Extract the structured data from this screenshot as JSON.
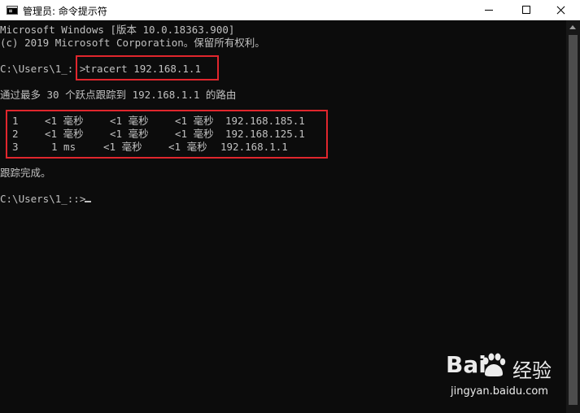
{
  "window": {
    "title": "管理员: 命令提示符",
    "icon": "cmd-icon"
  },
  "console": {
    "lines": [
      "Microsoft Windows [版本 10.0.18363.900]",
      "(c) 2019 Microsoft Corporation。保留所有权利。",
      "C:\\Users\\1_::>",
      "tracert 192.168.1.1",
      "通过最多 30 个跃点跟踪到 192.168.1.1 的路由",
      "跟踪完成。",
      "C:\\Users\\1_::>"
    ],
    "hops": [
      {
        "hop": "1",
        "t1": "<1 毫秒",
        "t2": "<1 毫秒",
        "t3": "<1 毫秒",
        "ip": "192.168.185.1"
      },
      {
        "hop": "2",
        "t1": "<1 毫秒",
        "t2": "<1 毫秒",
        "t3": "<1 毫秒",
        "ip": "192.168.125.1"
      },
      {
        "hop": "3",
        "t1": "1 ms",
        "t2": "<1 毫秒",
        "t3": "<1 毫秒",
        "ip": "192.168.1.1"
      }
    ]
  },
  "highlight_color": "#e0262d",
  "watermark": {
    "brand": "Bai",
    "brand2": "经验",
    "url": "jingyan.baidu.com"
  }
}
